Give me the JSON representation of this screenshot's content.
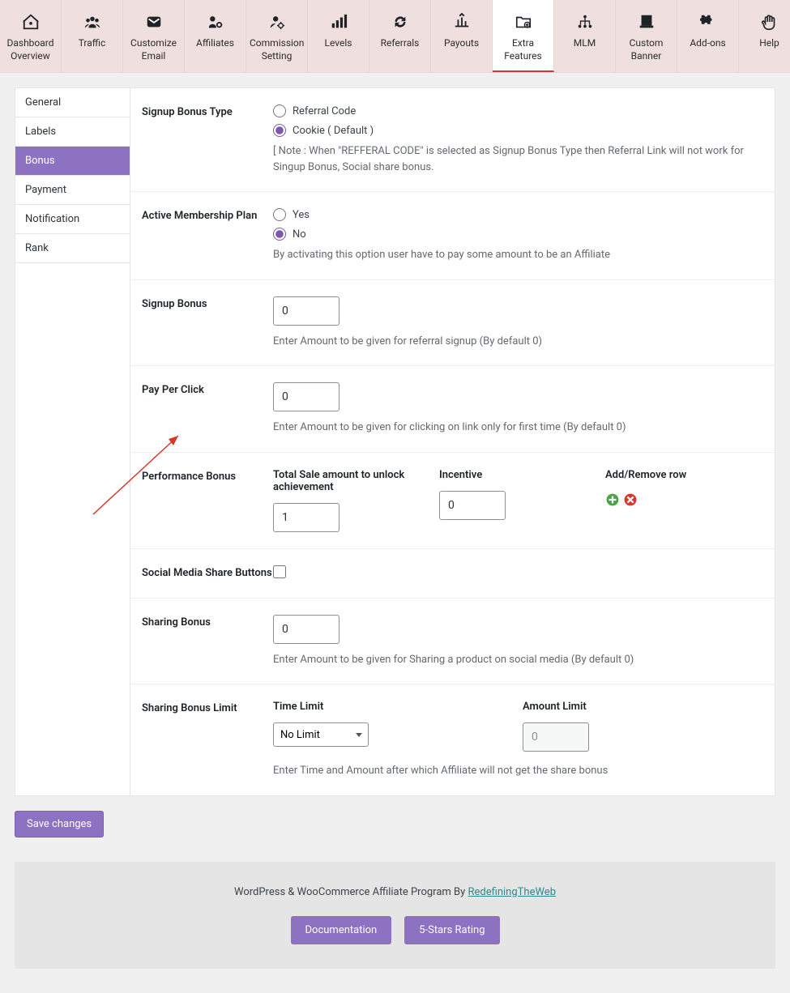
{
  "topnav": [
    {
      "label": "Dashboard Overview",
      "icon": "home"
    },
    {
      "label": "Traffic",
      "icon": "users"
    },
    {
      "label": "Customize Email",
      "icon": "mail"
    },
    {
      "label": "Affiliates",
      "icon": "affiliate"
    },
    {
      "label": "Commission Setting",
      "icon": "person-gear"
    },
    {
      "label": "Levels",
      "icon": "bars"
    },
    {
      "label": "Referrals",
      "icon": "cycle"
    },
    {
      "label": "Payouts",
      "icon": "payout"
    },
    {
      "label": "Extra Features",
      "icon": "folder-plus"
    },
    {
      "label": "MLM",
      "icon": "tree"
    },
    {
      "label": "Custom Banner",
      "icon": "banner"
    },
    {
      "label": "Add-ons",
      "icon": "puzzle"
    },
    {
      "label": "Help",
      "icon": "hand"
    }
  ],
  "topnav_active_index": 8,
  "sidebar": {
    "items": [
      {
        "label": "General"
      },
      {
        "label": "Labels"
      },
      {
        "label": "Bonus"
      },
      {
        "label": "Payment"
      },
      {
        "label": "Notification"
      },
      {
        "label": "Rank"
      }
    ],
    "active_index": 2
  },
  "form": {
    "signup_bonus_type": {
      "label": "Signup Bonus Type",
      "options": [
        {
          "label": "Referral Code",
          "checked": false
        },
        {
          "label": "Cookie ( Default )",
          "checked": true
        }
      ],
      "note": "[ Note : When \"REFFERAL CODE\" is selected as Signup Bonus Type then Referral Link will not work for Singup Bonus, Social share bonus."
    },
    "active_membership": {
      "label": "Active Membership Plan",
      "options": [
        {
          "label": "Yes",
          "checked": false
        },
        {
          "label": "No",
          "checked": true
        }
      ],
      "note": "By activating this option user have to pay some amount to be an Affiliate"
    },
    "signup_bonus": {
      "label": "Signup Bonus",
      "value": "0",
      "note": "Enter Amount to be given for referral signup (By default 0)"
    },
    "pay_per_click": {
      "label": "Pay Per Click",
      "value": "0",
      "note": "Enter Amount to be given for clicking on link only for first time (By default 0)"
    },
    "performance_bonus": {
      "label": "Performance Bonus",
      "col1_head": "Total Sale amount to unlock achievement",
      "col2_head": "Incentive",
      "col3_head": "Add/Remove row",
      "total_sale": "1",
      "incentive": "0"
    },
    "social_share_buttons": {
      "label": "Social Media Share Buttons",
      "checked": false
    },
    "sharing_bonus": {
      "label": "Sharing Bonus",
      "value": "0",
      "note": "Enter Amount to be given for Sharing a product on social media (By default 0)"
    },
    "sharing_bonus_limit": {
      "label": "Sharing Bonus Limit",
      "time_limit_head": "Time Limit",
      "amount_limit_head": "Amount Limit",
      "time_limit_value": "No Limit",
      "amount_limit_value": "0",
      "note": "Enter Time and Amount after which Affiliate will not get the share bonus"
    }
  },
  "save_button": "Save changes",
  "footer": {
    "text_prefix": "WordPress & WooCommerce Affiliate Program By ",
    "link_text": "RedefiningTheWeb",
    "btn_doc": "Documentation",
    "btn_rating": "5-Stars Rating"
  }
}
